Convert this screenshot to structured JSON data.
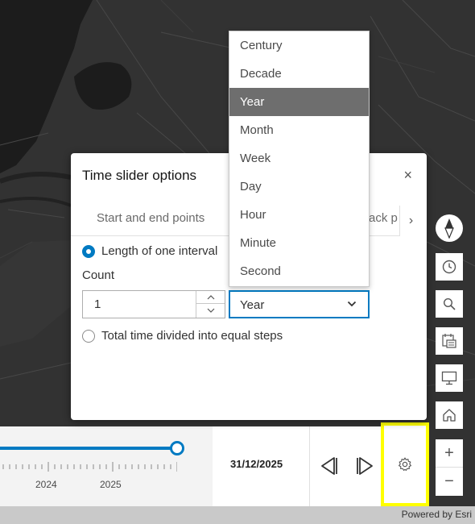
{
  "map": {
    "attribution": "Powered by Esri"
  },
  "dialog": {
    "title": "Time slider options",
    "close_label": "×",
    "tabs": {
      "start_end": "Start and end points",
      "playback_partial": "ack p",
      "next_label": "›"
    },
    "length_option": "Length of one interval",
    "count_label": "Count",
    "count_value": "1",
    "unit_value": "Year",
    "total_option": "Total time divided into equal steps"
  },
  "dropdown": {
    "options": [
      "Century",
      "Decade",
      "Year",
      "Month",
      "Week",
      "Day",
      "Hour",
      "Minute",
      "Second"
    ],
    "selected": "Year"
  },
  "toolbar": {
    "zoom_in": "+",
    "zoom_out": "−",
    "icons": [
      "compass-icon",
      "clock-icon",
      "search-icon",
      "layers-icon",
      "screen-icon",
      "home-icon"
    ]
  },
  "time_slider": {
    "years": [
      "2024",
      "2025"
    ],
    "date": "31/12/2025",
    "accent": "#007ac2"
  },
  "highlight_color": "#ffff00"
}
